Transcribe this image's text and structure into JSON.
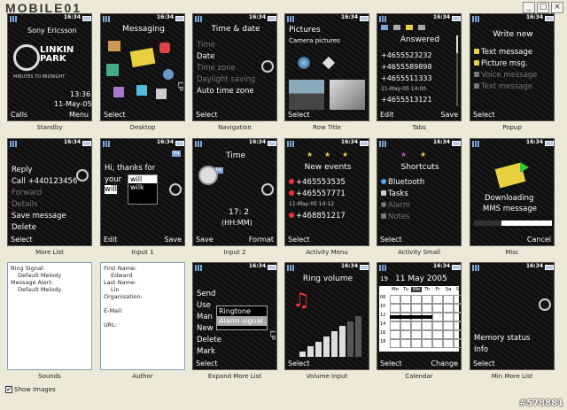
{
  "app": {
    "logo": "MOBILE01",
    "window_buttons": [
      "_",
      "□",
      "×"
    ]
  },
  "status_time": "16:34",
  "screens": {
    "standby": {
      "caption": "Standby",
      "brand": "Sony Ericsson",
      "band": "LINKIN PARK",
      "subtitle": "MINUTES TO MIDNIGHT",
      "clock": "13:36",
      "date": "11-May-05",
      "left": "Calls",
      "right": "Menu"
    },
    "desktop": {
      "caption": "Desktop",
      "title": "Messaging",
      "left": "Select"
    },
    "navigation": {
      "caption": "Navigation",
      "title": "Time & date",
      "items": [
        "Time",
        "Date",
        "Time zone",
        "Daylight saving",
        "Auto time zone"
      ],
      "left": "Select"
    },
    "rowtitle": {
      "caption": "Row Title",
      "title": "Pictures",
      "sub": "Camera pictures",
      "left": "Select"
    },
    "tabs": {
      "caption": "Tabs",
      "title": "Answered",
      "items": [
        "+4655523232",
        "+4655589898",
        "+4655511333",
        "11-May-05  14:00",
        "+4655513121"
      ],
      "left": "Edit",
      "right": "Save"
    },
    "popup": {
      "caption": "Popup",
      "title": "Write new",
      "items": [
        "Text message",
        "Picture msg.",
        "Voice message",
        "Text message"
      ],
      "left": "Select"
    },
    "morelist": {
      "caption": "More List",
      "items": [
        "Reply",
        "Call +440123456",
        "Forward",
        "Details",
        "Save message",
        "Delete"
      ],
      "left": "Select"
    },
    "input1": {
      "caption": "Input 1",
      "text1": "Hi, thanks for",
      "text2": "your",
      "text3": "will",
      "pop": [
        "will",
        "wilk"
      ],
      "left": "Edit",
      "right": "Save"
    },
    "input2": {
      "caption": "Input 2",
      "title": "Time",
      "value": "17: 2",
      "format": "(HH:MM)",
      "left": "Save",
      "right": "Format"
    },
    "activitymenu": {
      "caption": "Activity Menu",
      "title": "New events",
      "items": [
        "+465553535",
        "+465557771",
        "11-May-05  14:12",
        "+468851217"
      ],
      "left": "Select"
    },
    "activitysmall": {
      "caption": "Activity Small",
      "title": "Shortcuts",
      "items": [
        "Bluetooth",
        "Tasks",
        "Alarm",
        "Notes"
      ],
      "left": "Select"
    },
    "misc": {
      "caption": "Misc",
      "line1": "Downloading",
      "line2": "MMS message",
      "right": "Cancel"
    },
    "sounds": {
      "caption": "Sounds",
      "lines": [
        "Ring Signal:",
        "Default Melody",
        "Message Alert:",
        "Default Melody"
      ]
    },
    "author": {
      "caption": "Author",
      "lines": [
        "First Name:",
        "Edward",
        "Last Name:",
        "Lin",
        "Organisation:",
        "",
        "E-Mail:",
        "",
        "URL:"
      ]
    },
    "expandmore": {
      "caption": "Expand More List",
      "items": [
        "Send",
        "Use",
        "Man",
        "New",
        "Delete",
        "Mark"
      ],
      "popup": [
        "Ringtone",
        "Alarm signal"
      ],
      "left": "Select"
    },
    "volume": {
      "caption": "Volume Input",
      "title": "Ring volume",
      "level": 0.85,
      "left": "Select"
    },
    "calendar": {
      "caption": "Calendar",
      "day": "19",
      "title": "11 May 2005",
      "days": [
        "Mo",
        "Tu",
        "We",
        "Th",
        "Fr",
        "Sa",
        "Su"
      ],
      "hours": [
        "08",
        "10",
        "12",
        "14",
        "16",
        "18"
      ],
      "left": "Select",
      "right": "Change"
    },
    "minmore": {
      "caption": "Min More List",
      "items": [
        "Memory status",
        "Info"
      ],
      "left": "Select"
    }
  },
  "checkbox": {
    "label": "Show Images",
    "checked": "✔"
  },
  "forum_id": "#578881",
  "colors": {
    "screen_bg": "#0e0e0e",
    "highlight": "#ffffff",
    "accent_blue": "#7aa7d8"
  }
}
